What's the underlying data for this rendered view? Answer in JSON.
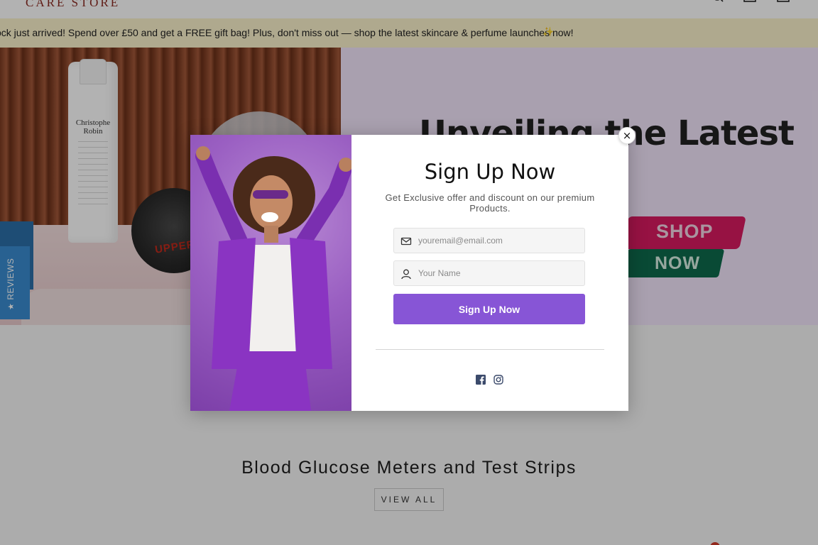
{
  "header": {
    "logo_text": "CARE STORE",
    "icons": [
      "search-icon",
      "account-icon",
      "cart-icon"
    ]
  },
  "announcement": {
    "text": "ock just arrived! Spend over £50 and get a FREE gift bag! Plus, don't miss out — shop the latest skincare & perfume launches now!",
    "emoji": "✨"
  },
  "hero": {
    "headline": "Unveiling the Latest",
    "product_label_1": "Christophe Robin",
    "product_label_2": "UPPERC",
    "cta_line_1": "SHOP",
    "cta_line_2": "NOW"
  },
  "reviews_tab": {
    "label": "REVIEWS",
    "icon": "star-icon"
  },
  "popup": {
    "title": "Sign Up Now",
    "subtitle": "Get Exclusive offer and discount on our premium Products.",
    "email_placeholder": "youremail@email.com",
    "name_placeholder": "Your Name",
    "submit_label": "Sign Up Now",
    "close_symbol": "×",
    "social_icons": [
      "facebook-icon",
      "instagram-icon"
    ]
  },
  "section": {
    "title": "Blood Glucose Meters and Test Strips",
    "view_all_label": "VIEW ALL"
  },
  "colors": {
    "accent_purple": "#8755d6",
    "announcement_bg": "#fbf3cc",
    "reviews_blue": "#3a8bd0",
    "shop_pink": "#d81b60",
    "shop_green": "#0e6b4c",
    "logo_red": "#8b2a22"
  }
}
